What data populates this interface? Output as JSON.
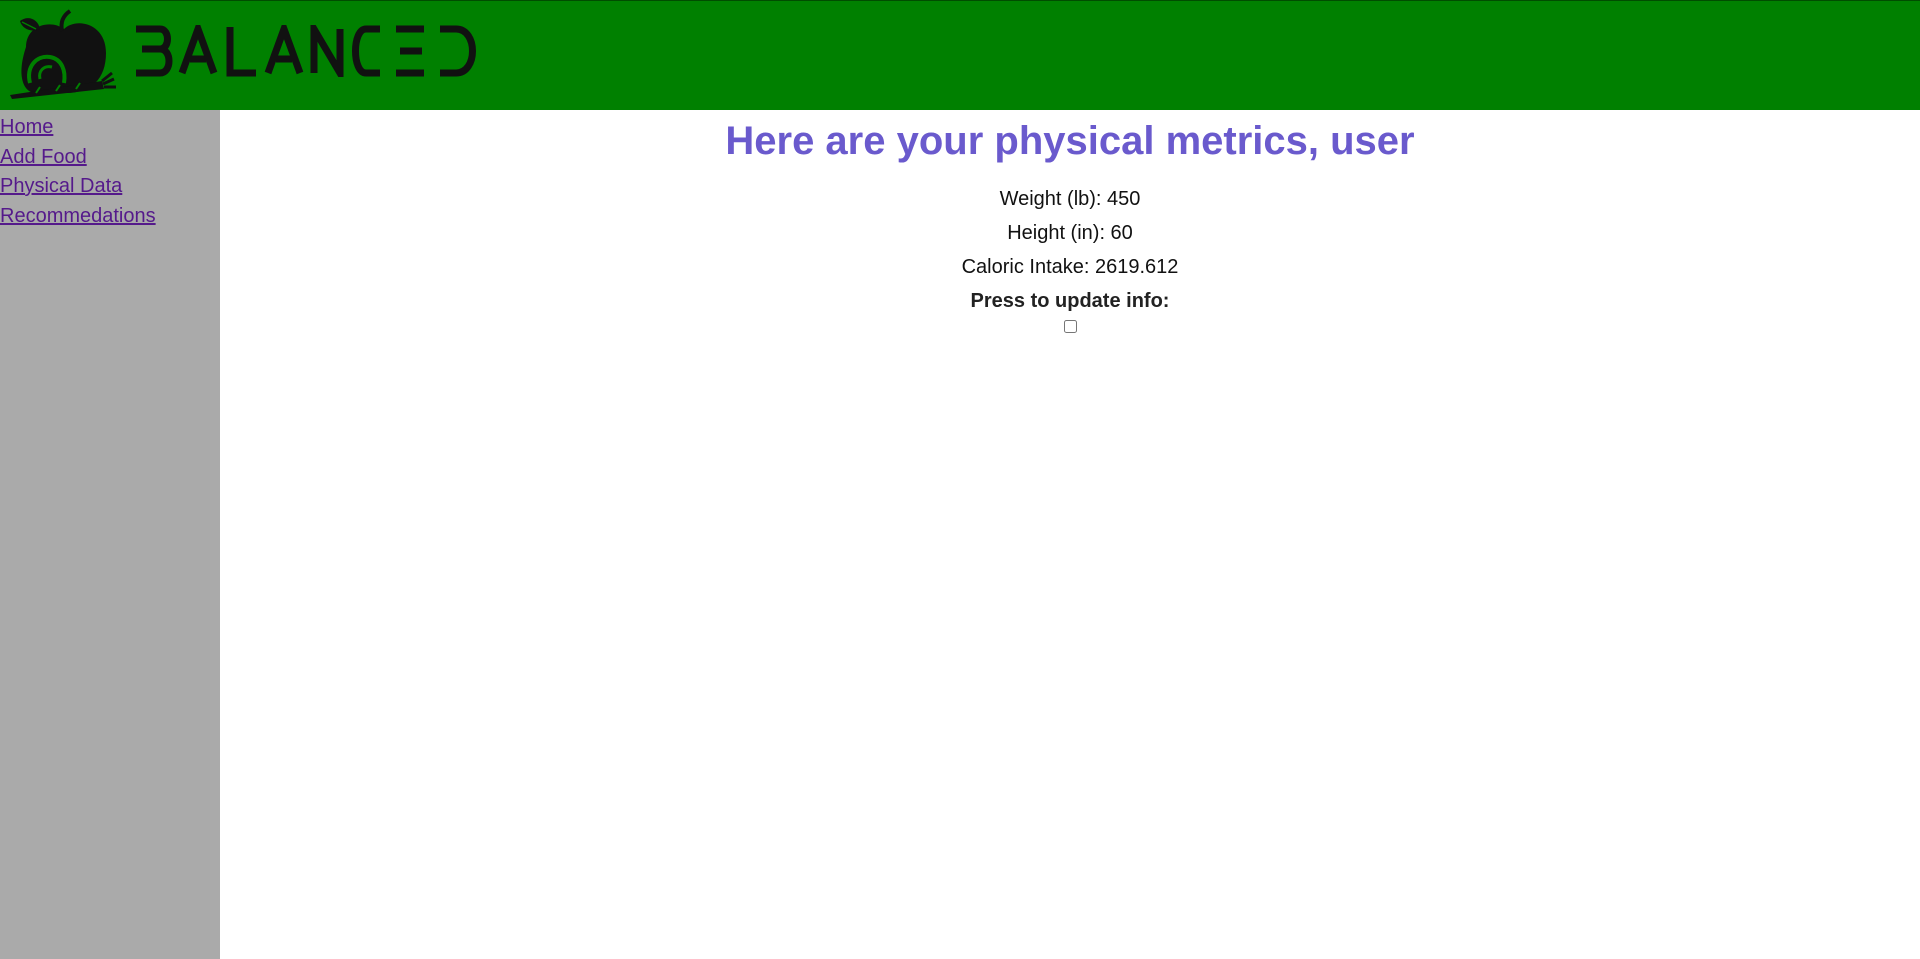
{
  "header": {
    "brand_name": "BALANCED",
    "background_color": "#008000",
    "logo_icon": "apple-carrot-icon"
  },
  "sidebar": {
    "background_color": "#aaaaaa",
    "items": [
      {
        "label": "Home"
      },
      {
        "label": "Add Food"
      },
      {
        "label": "Physical Data"
      },
      {
        "label": "Recommedations"
      }
    ]
  },
  "main": {
    "title": "Here are your physical metrics, user",
    "title_color": "#6a5acd",
    "weight": "Weight (lb): 450",
    "height": "Height (in): 60",
    "caloric_intake": "Caloric Intake: 2619.612",
    "update_label": "Press to update info:",
    "update_checked": false
  }
}
